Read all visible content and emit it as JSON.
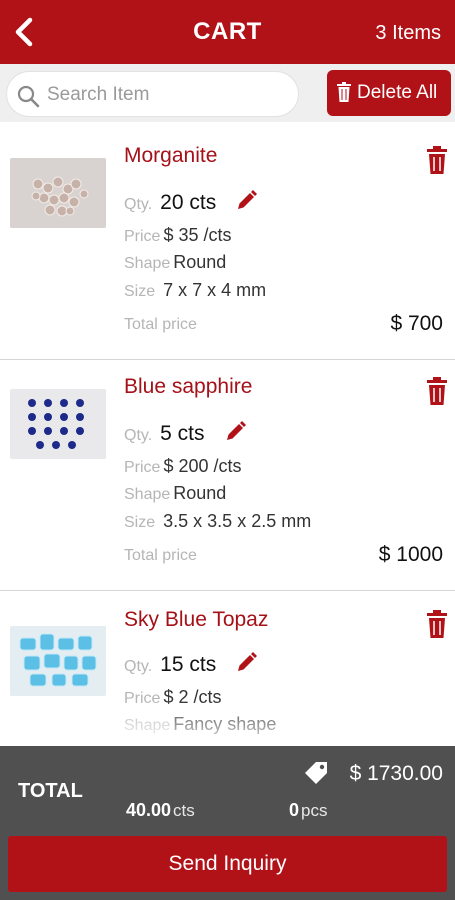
{
  "header": {
    "title": "CART",
    "item_count": "3 Items"
  },
  "search": {
    "placeholder": "Search Item",
    "value": ""
  },
  "actions": {
    "delete_all_label": "Delete All"
  },
  "labels": {
    "qty": "Qty.",
    "price": "Price",
    "shape": "Shape",
    "size": "Size",
    "total_price": "Total price"
  },
  "items": [
    {
      "name": "Morganite",
      "qty": "20 cts",
      "price": "$ 35 /cts",
      "shape": "Round",
      "size": "7 x 7 x 4 mm",
      "total": "$ 700",
      "thumb_color": "#c9b8b0"
    },
    {
      "name": "Blue sapphire",
      "qty": "5 cts",
      "price": "$ 200 /cts",
      "shape": "Round",
      "size": "3.5 x 3.5 x 2.5 mm",
      "total": "$ 1000",
      "thumb_color": "#1d2a8a"
    },
    {
      "name": "Sky Blue Topaz",
      "qty": "15 cts",
      "price": "$ 2 /cts",
      "shape": "Fancy shape",
      "total": "",
      "thumb_color": "#4fb6e0"
    }
  ],
  "footer": {
    "total_label": "TOTAL",
    "total_amount": "$ 1730.00",
    "carats_value": "40.00",
    "carats_unit": "cts",
    "pieces_value": "0",
    "pieces_unit": "pcs",
    "send_label": "Send Inquiry"
  },
  "colors": {
    "brand": "#b01218",
    "item_name": "#a51118",
    "footer_bg": "#505050"
  }
}
